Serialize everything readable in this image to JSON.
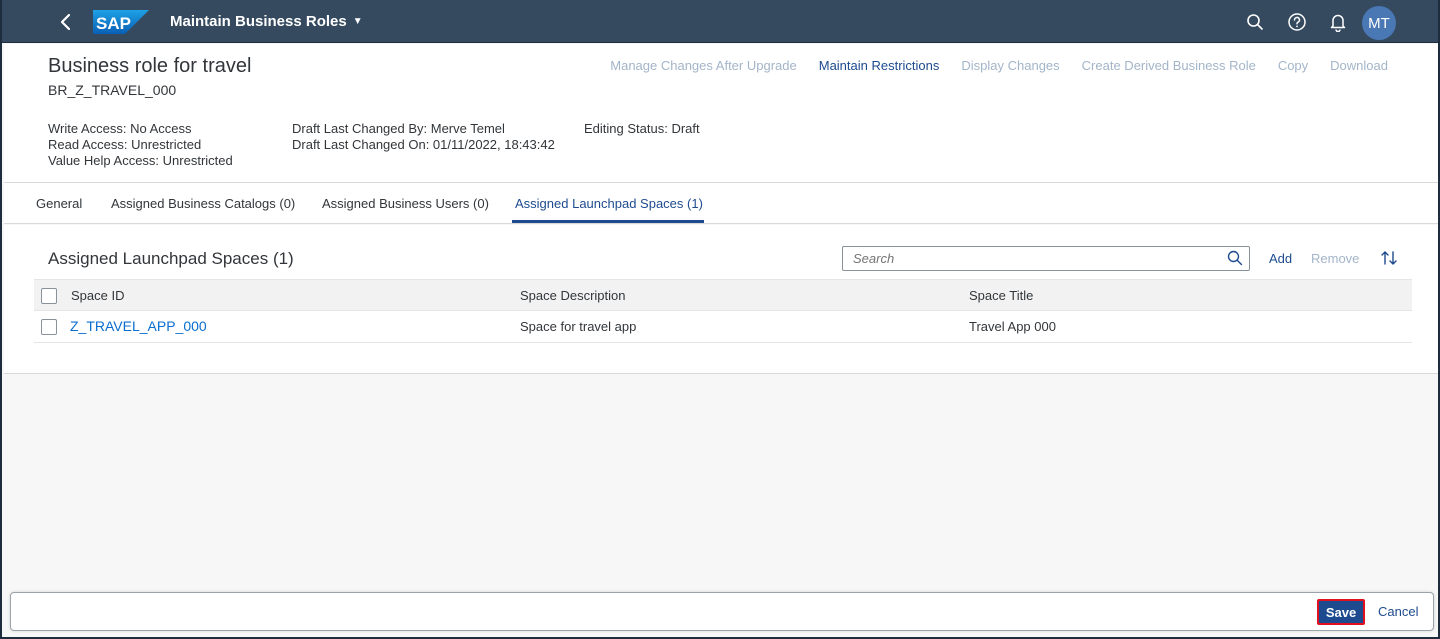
{
  "shell": {
    "app_title": "Maintain Business Roles",
    "logo_text": "SAP",
    "avatar_initials": "MT",
    "colors": {
      "shell_bg": "#354a5f",
      "avatar_bg": "#4a78b5"
    }
  },
  "header": {
    "title": "Business role for travel",
    "subtitle": "BR_Z_TRAVEL_000",
    "actions": [
      {
        "label": "Manage Changes After Upgrade",
        "enabled": false
      },
      {
        "label": "Maintain Restrictions",
        "enabled": true
      },
      {
        "label": "Display Changes",
        "enabled": false
      },
      {
        "label": "Create Derived Business Role",
        "enabled": false
      },
      {
        "label": "Copy",
        "enabled": false
      },
      {
        "label": "Download",
        "enabled": false
      }
    ],
    "attributes_col1": [
      "Write Access: No Access",
      "Read Access: Unrestricted",
      "Value Help Access: Unrestricted"
    ],
    "attributes_col2": [
      "Draft Last Changed By: Merve Temel",
      "Draft Last Changed On: 01/11/2022, 18:43:42"
    ],
    "attributes_col3": [
      "Editing Status: Draft"
    ]
  },
  "tabs": [
    {
      "label": "General",
      "active": false
    },
    {
      "label": "Assigned Business Catalogs (0)",
      "active": false
    },
    {
      "label": "Assigned Business Users (0)",
      "active": false
    },
    {
      "label": "Assigned Launchpad Spaces (1)",
      "active": true
    }
  ],
  "table": {
    "title": "Assigned Launchpad Spaces (1)",
    "search_placeholder": "Search",
    "add_label": "Add",
    "remove_label": "Remove",
    "columns": [
      "Space ID",
      "Space Description",
      "Space Title"
    ],
    "rows": [
      {
        "space_id": "Z_TRAVEL_APP_000",
        "space_description": "Space for travel app",
        "space_title": "Travel App 000"
      }
    ]
  },
  "footer": {
    "save_label": "Save",
    "cancel_label": "Cancel"
  }
}
